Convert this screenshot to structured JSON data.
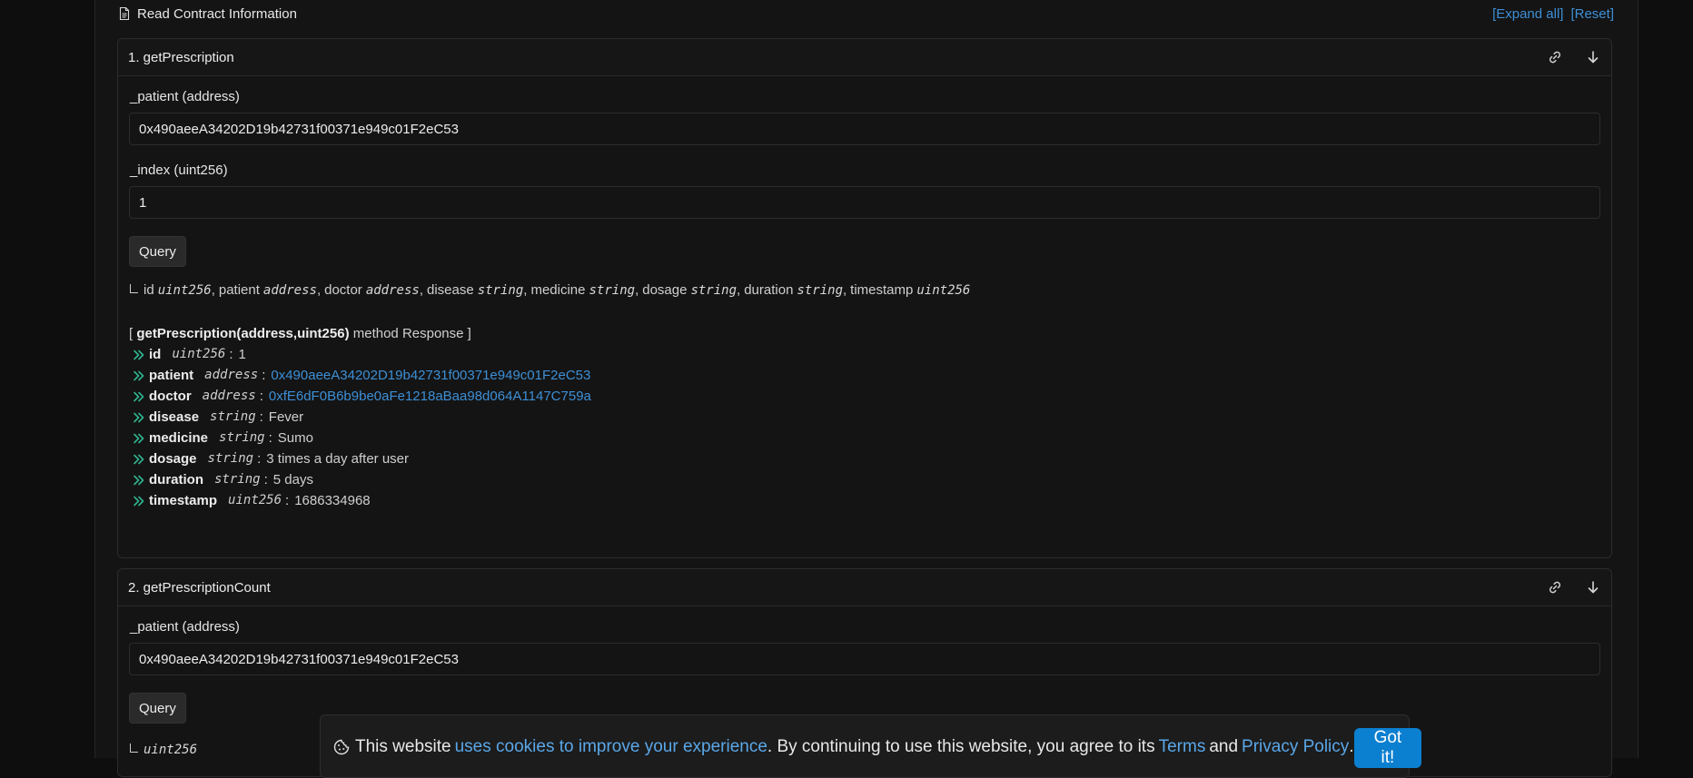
{
  "section": {
    "title": "Read Contract Information",
    "expand_all": "[Expand all]",
    "reset": "[Reset]"
  },
  "methods": [
    {
      "title": "1. getPrescription",
      "inputs": [
        {
          "label": "_patient (address)",
          "value": "0x490aeeA34202D19b42731f00371e949c01F2eC53"
        },
        {
          "label": "_index (uint256)",
          "value": "1"
        }
      ],
      "query_label": "Query",
      "signature": [
        {
          "name": "id",
          "type": "uint256"
        },
        {
          "name": "patient",
          "type": "address"
        },
        {
          "name": "doctor",
          "type": "address"
        },
        {
          "name": "disease",
          "type": "string"
        },
        {
          "name": "medicine",
          "type": "string"
        },
        {
          "name": "dosage",
          "type": "string"
        },
        {
          "name": "duration",
          "type": "string"
        },
        {
          "name": "timestamp",
          "type": "uint256"
        }
      ],
      "response": {
        "open": "[ ",
        "method": "getPrescription(address,uint256)",
        "suffix": " method Response ]",
        "rows": [
          {
            "key": "id",
            "type": "uint256",
            "value": "1"
          },
          {
            "key": "patient",
            "type": "address",
            "value": "0x490aeeA34202D19b42731f00371e949c01F2eC53"
          },
          {
            "key": "doctor",
            "type": "address",
            "value": "0xfE6dF0B6b9be0aFe1218aBaa98d064A1147C759a"
          },
          {
            "key": "disease",
            "type": "string",
            "value": "Fever"
          },
          {
            "key": "medicine",
            "type": "string",
            "value": "Sumo"
          },
          {
            "key": "dosage",
            "type": "string",
            "value": "3 times a day after user"
          },
          {
            "key": "duration",
            "type": "string",
            "value": "5 days"
          },
          {
            "key": "timestamp",
            "type": "uint256",
            "value": "1686334968"
          }
        ]
      }
    },
    {
      "title": "2. getPrescriptionCount",
      "inputs": [
        {
          "label": "_patient (address)",
          "value": "0x490aeeA34202D19b42731f00371e949c01F2eC53"
        }
      ],
      "query_label": "Query",
      "return_type": "uint256"
    }
  ],
  "cookie": {
    "text1": "This website",
    "link1": "uses cookies to improve your experience",
    "text2": ". By continuing to use this website, you agree to its",
    "terms": "Terms",
    "and": "and",
    "privacy": "Privacy Policy",
    "period": ".",
    "button": "Got it!"
  },
  "colors": {
    "link": "#3d8fd6",
    "chevron": "#2fb58f",
    "button_primary": "#0b7fd0"
  }
}
